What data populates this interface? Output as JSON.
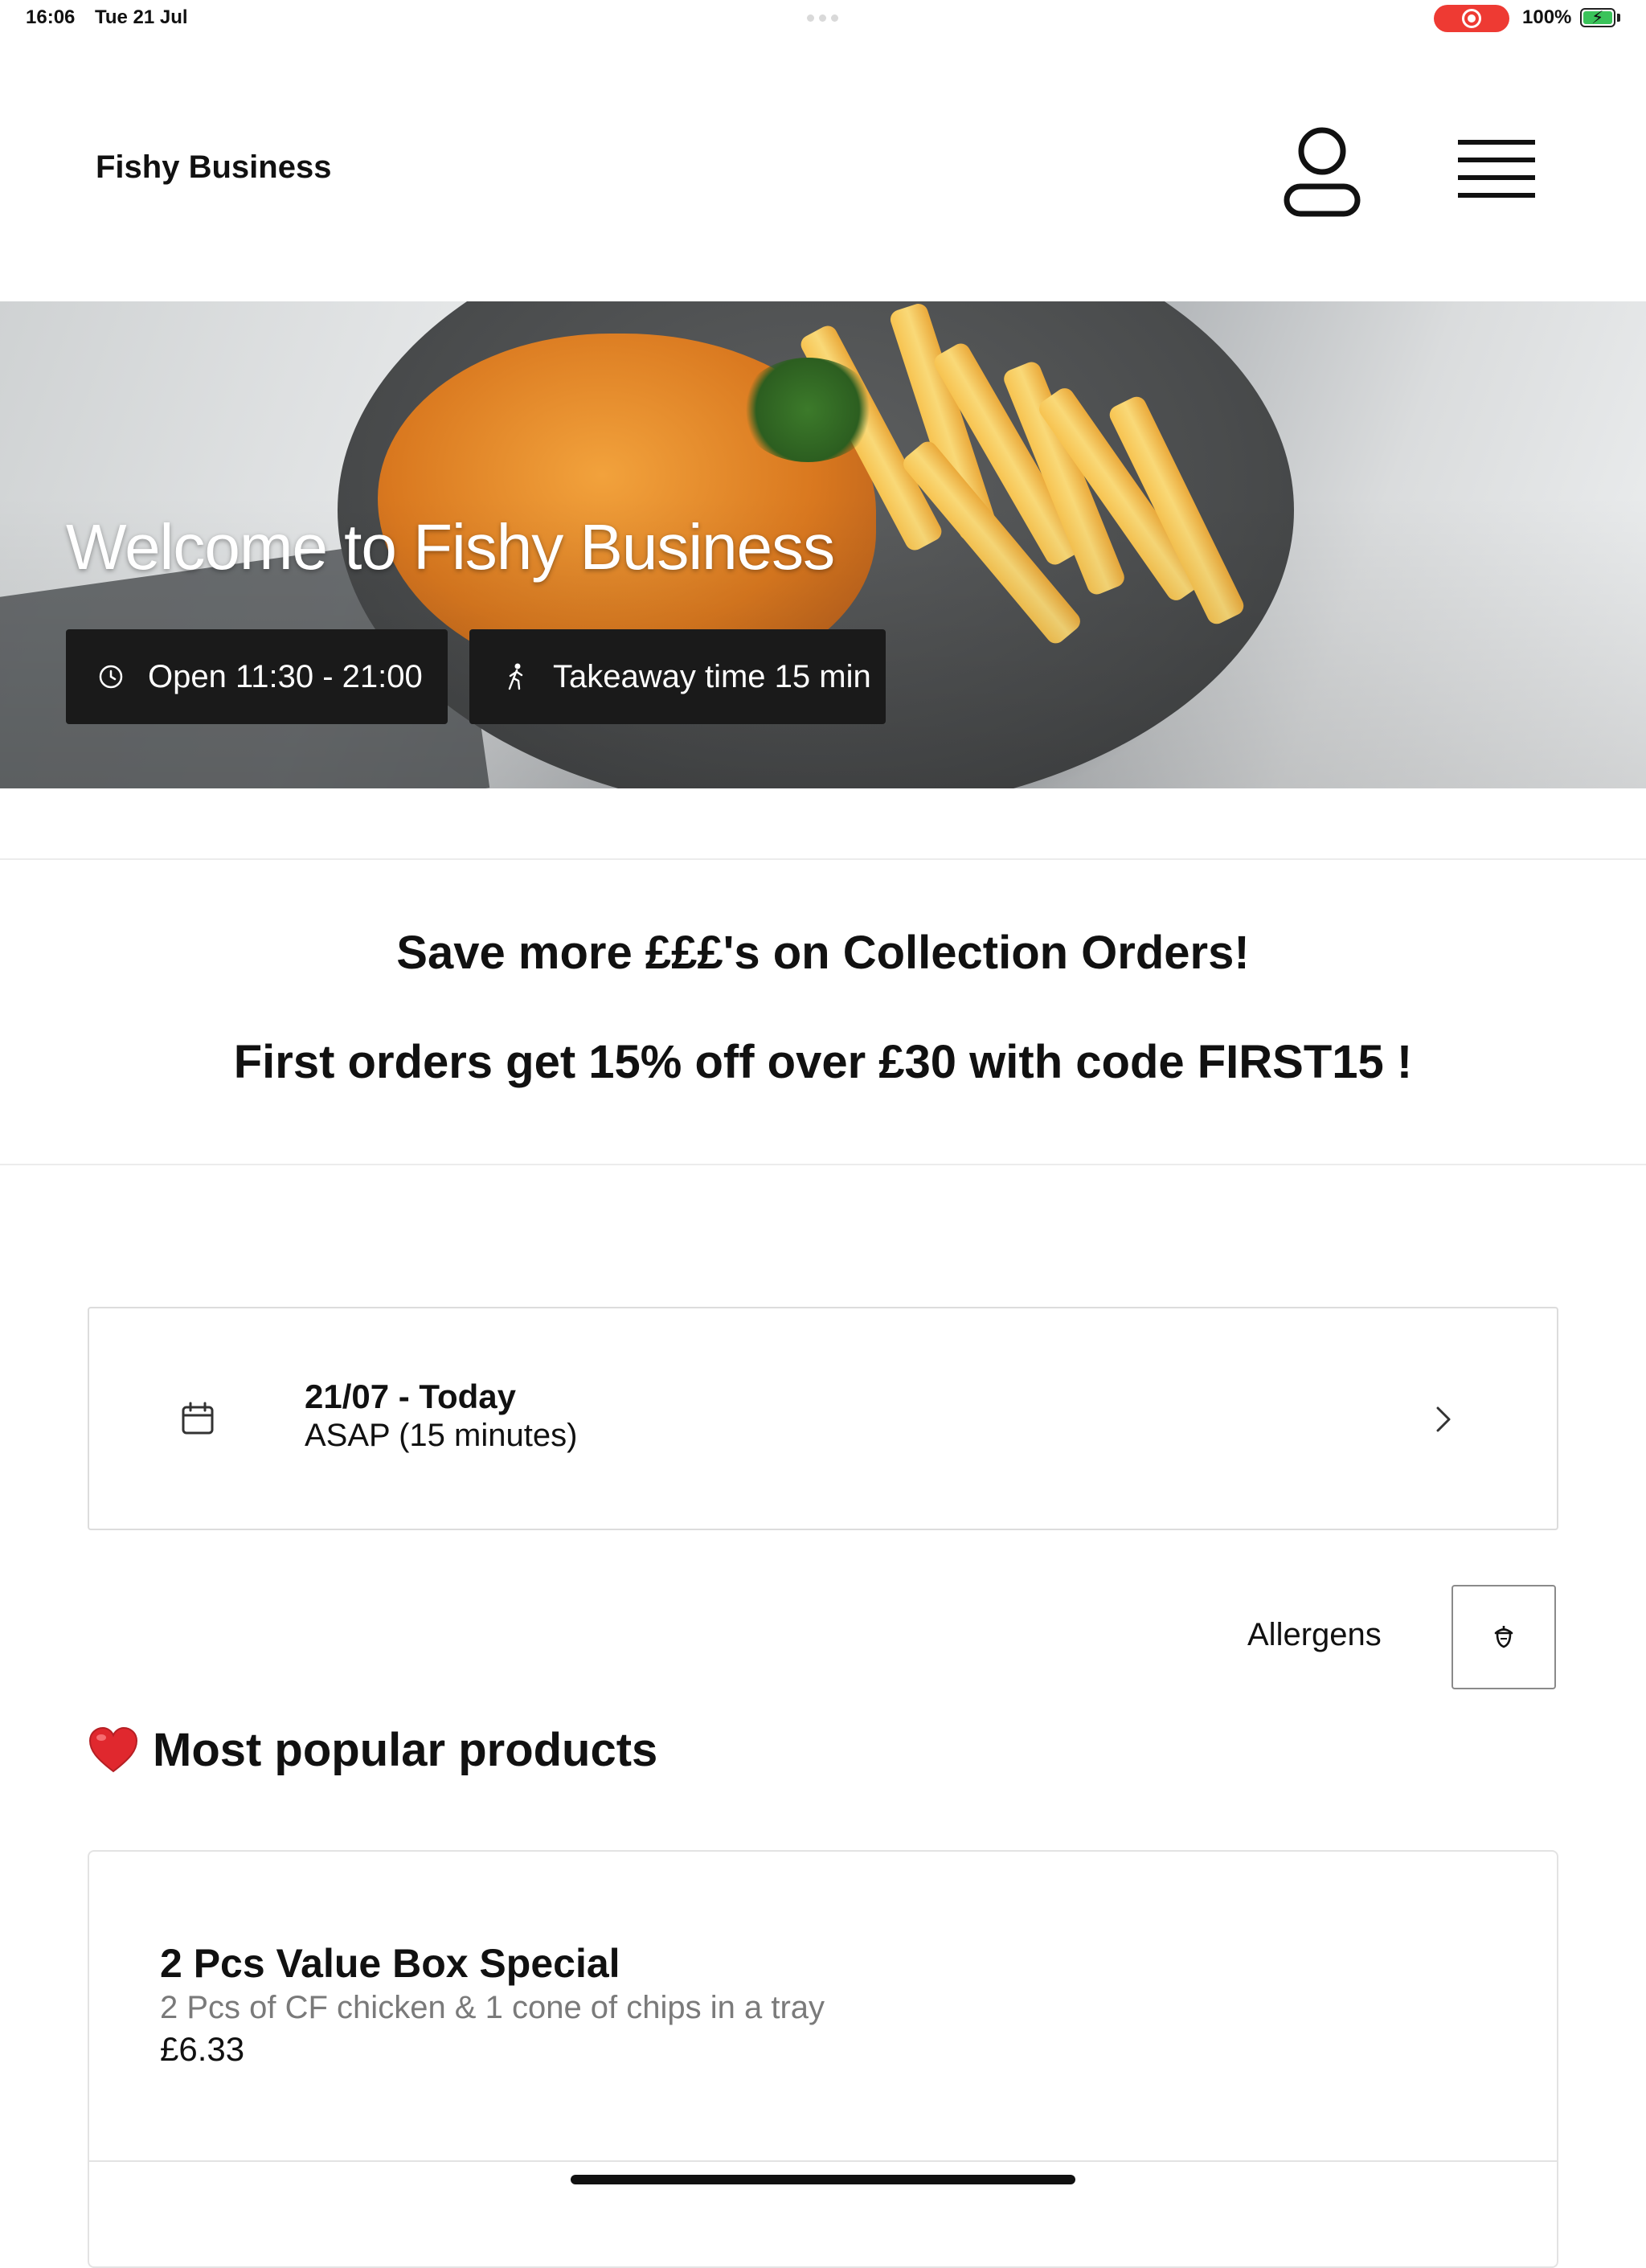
{
  "status_bar": {
    "time": "16:06",
    "date": "Tue 21 Jul",
    "battery": "100%"
  },
  "header": {
    "brand": "Fishy Business",
    "account_icon": "user-icon",
    "menu_icon": "hamburger-menu-icon"
  },
  "hero": {
    "title": "Welcome to Fishy Business",
    "open_hours": "Open 11:30 - 21:00",
    "takeaway_time": "Takeaway time 15 min",
    "open_icon": "clock-icon",
    "takeaway_icon": "walking-person-icon"
  },
  "promo": {
    "line1": "Save more £££'s on Collection Orders!",
    "line2": "First orders get 15% off over £30 with code FIRST15 !"
  },
  "time_selector": {
    "day": "21/07 - Today",
    "slot": "ASAP (15 minutes)",
    "icon": "calendar-icon"
  },
  "allergens": {
    "label": "Allergens",
    "icon": "acorn-icon"
  },
  "popular": {
    "heading": "Most popular products",
    "products": [
      {
        "name": "2 Pcs Value Box Special",
        "description": "2 Pcs of CF chicken & 1 cone of chips in a tray",
        "price": "£6.33"
      }
    ]
  },
  "colors": {
    "accent": "#111111",
    "recording": "#ee3a33",
    "battery": "#3ac35a",
    "muted_text": "#7a7a7a"
  }
}
